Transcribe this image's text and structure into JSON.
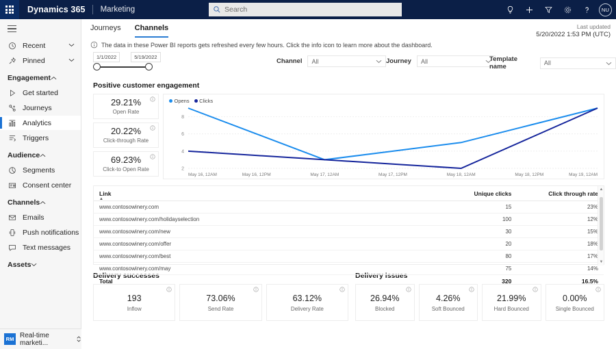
{
  "topbar": {
    "waffle_icon": "app-launcher-icon",
    "brand": "Dynamics 365",
    "app_name": "Marketing",
    "search_placeholder": "Search",
    "search_value": "",
    "icons": [
      {
        "name": "lightbulb-icon",
        "glyph": "insights"
      },
      {
        "name": "plus-icon",
        "glyph": "new"
      },
      {
        "name": "filter-icon",
        "glyph": "filter"
      },
      {
        "name": "gear-icon",
        "glyph": "settings"
      },
      {
        "name": "question-icon",
        "glyph": "help"
      }
    ],
    "avatar_initials": "NU"
  },
  "sidebar": {
    "hamburger": "menu-icon",
    "items": [
      {
        "label": "Recent",
        "icon": "clock-icon",
        "type": "item",
        "chevron": "down",
        "active": false
      },
      {
        "label": "Pinned",
        "icon": "pin-icon",
        "type": "item",
        "chevron": "down",
        "active": false
      },
      {
        "label": "Engagement",
        "type": "group",
        "chevron": "up"
      },
      {
        "label": "Get started",
        "icon": "play-icon",
        "type": "item",
        "active": false
      },
      {
        "label": "Journeys",
        "icon": "journeys-icon",
        "type": "item",
        "active": false
      },
      {
        "label": "Analytics",
        "icon": "analytics-icon",
        "type": "item",
        "active": true
      },
      {
        "label": "Triggers",
        "icon": "triggers-icon",
        "type": "item",
        "active": false
      },
      {
        "label": "Audience",
        "type": "group",
        "chevron": "up"
      },
      {
        "label": "Segments",
        "icon": "segments-icon",
        "type": "item",
        "active": false
      },
      {
        "label": "Consent center",
        "icon": "consent-icon",
        "type": "item",
        "active": false
      },
      {
        "label": "Channels",
        "type": "group",
        "chevron": "up"
      },
      {
        "label": "Emails",
        "icon": "mail-icon",
        "type": "item",
        "active": false
      },
      {
        "label": "Push notifications",
        "icon": "phone-icon",
        "type": "item",
        "active": false
      },
      {
        "label": "Text messages",
        "icon": "chat-icon",
        "type": "item",
        "active": false
      },
      {
        "label": "Assets",
        "type": "group",
        "chevron": "down"
      }
    ],
    "area_switcher": {
      "badge": "RM",
      "label": "Real-time marketi...",
      "icon": "updown-chevron-icon"
    }
  },
  "main": {
    "tabs": [
      {
        "label": "Journeys",
        "active": false
      },
      {
        "label": "Channels",
        "active": true
      }
    ],
    "last_updated_label": "Last updated",
    "last_updated_value": "5/20/2022 1:53 PM (UTC)",
    "info_banner": "The data in these Power BI reports gets refreshed every few hours. Click the info icon to learn more about the dashboard.",
    "info_icon": "info-icon"
  },
  "filters": {
    "date_from": "1/1/2022",
    "date_to": "5/19/2022",
    "dropdowns": [
      {
        "label": "Channel",
        "value": "All"
      },
      {
        "label": "Journey",
        "value": "All"
      },
      {
        "label": "Template name",
        "value": "All"
      }
    ]
  },
  "engagement": {
    "title": "Positive customer engagement",
    "kpis": [
      {
        "value": "29.21%",
        "label": "Open Rate"
      },
      {
        "value": "20.22%",
        "label": "Click-through Rate"
      },
      {
        "value": "69.23%",
        "label": "Click-to Open Rate"
      }
    ]
  },
  "chart_data": {
    "type": "line",
    "title": "Positive customer engagement",
    "xlabel": "",
    "ylabel": "",
    "x": [
      "May 16, 12AM",
      "May 16, 12PM",
      "May 17, 12AM",
      "May 17, 12PM",
      "May 18, 12AM",
      "May 18, 12PM",
      "May 19, 12AM"
    ],
    "ylim": [
      2,
      9
    ],
    "yticks": [
      2,
      4,
      6,
      8
    ],
    "grid": true,
    "legend_position": "top-left",
    "series": [
      {
        "name": "Opens",
        "color": "#1a8ced",
        "values": [
          9,
          6,
          3,
          4,
          5,
          7,
          9
        ]
      },
      {
        "name": "Clicks",
        "color": "#14249b",
        "values": [
          4,
          3.5,
          3,
          2.5,
          2,
          5.5,
          9
        ]
      }
    ]
  },
  "links_table": {
    "columns": [
      "Link",
      "Unique clicks",
      "Click through rate"
    ],
    "sort_column": "Link",
    "rows": [
      {
        "link": "www.contosowinery.com",
        "clicks": "15",
        "rate": "23%"
      },
      {
        "link": "www.contosowinery.com/holidayselection",
        "clicks": "100",
        "rate": "12%"
      },
      {
        "link": "www.contosowinery.com/new",
        "clicks": "30",
        "rate": "15%"
      },
      {
        "link": "www.contosowinery.com/offer",
        "clicks": "20",
        "rate": "18%"
      },
      {
        "link": "www.contosowinery.com/best",
        "clicks": "80",
        "rate": "17%"
      },
      {
        "link": "www.contosowinery.com/may",
        "clicks": "75",
        "rate": "14%"
      }
    ],
    "total": {
      "link": "Total",
      "clicks": "320",
      "rate": "16.5%"
    }
  },
  "delivery_successes": {
    "title": "Delivery successes",
    "cards": [
      {
        "value": "193",
        "label": "Inflow"
      },
      {
        "value": "73.06%",
        "label": "Send Rate"
      },
      {
        "value": "63.12%",
        "label": "Delivery Rate"
      }
    ]
  },
  "delivery_issues": {
    "title": "Delivery issues",
    "cards": [
      {
        "value": "26.94%",
        "label": "Blocked"
      },
      {
        "value": "4.26%",
        "label": "Soft Bounced"
      },
      {
        "value": "21.99%",
        "label": "Hard Bounced"
      },
      {
        "value": "0.00%",
        "label": "Single Bounced"
      }
    ]
  },
  "colors": {
    "topbar": "#0b1f47",
    "accent": "#1b72d4",
    "tab_underline": "#2b7cd3",
    "opens": "#1a8ced",
    "clicks": "#14249b"
  }
}
